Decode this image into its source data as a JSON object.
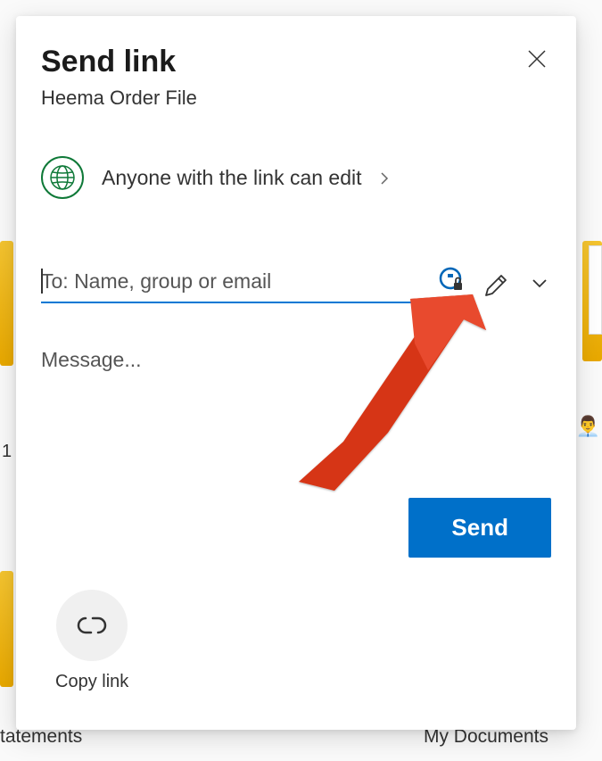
{
  "dialog": {
    "title": "Send link",
    "subtitle": "Heema Order File",
    "permission_text": "Anyone with the link can edit",
    "recipient_placeholder": "To: Name, group or email",
    "message_placeholder": "Message...",
    "send_label": "Send",
    "copy_link_label": "Copy link"
  },
  "background": {
    "text_bottom_left": "tatements",
    "text_bottom_right": "My Documents",
    "text_mid_left": "1"
  }
}
